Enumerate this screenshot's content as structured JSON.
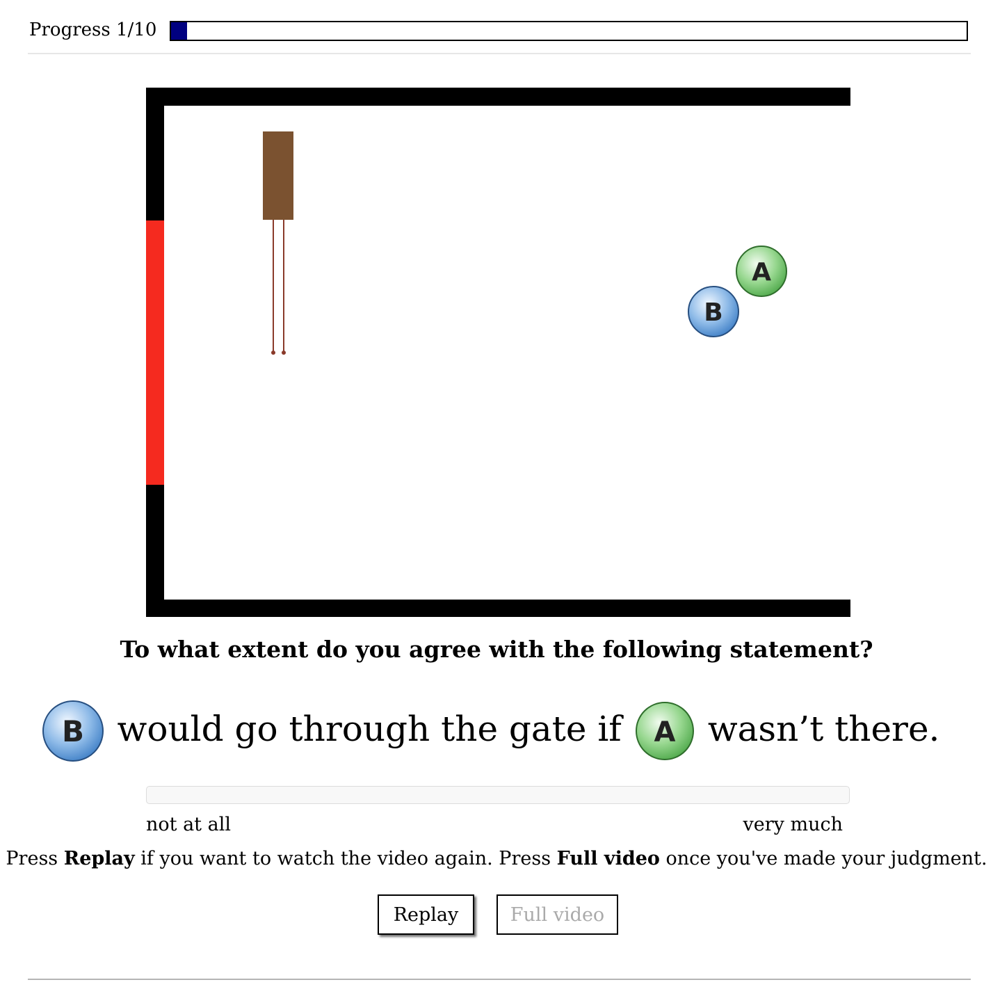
{
  "progress": {
    "label": "Progress 1/10",
    "fraction": 0.02,
    "fill_color": "#000080"
  },
  "scene": {
    "wall_color": "#000000",
    "gate_color": "#f52a1f",
    "block_color": "#7b5230",
    "balls": [
      {
        "id": "ball-a",
        "label": "A",
        "color": "#5cb85c"
      },
      {
        "id": "ball-b",
        "label": "B",
        "color": "#4a90d9"
      }
    ]
  },
  "question": "To what extent do you agree with the following statement?",
  "statement": {
    "ball_first": "B",
    "middle_text": "would go through the gate if",
    "ball_second": "A",
    "end_text": "wasn’t there."
  },
  "slider": {
    "left_label": "not at all",
    "right_label": "very much"
  },
  "instructions": {
    "part1": "Press ",
    "replay_bold": "Replay",
    "part2": " if you want to watch the video again. Press ",
    "full_bold": "Full video",
    "part3": " once you've made your judgment."
  },
  "buttons": {
    "replay": "Replay",
    "full_video": "Full video",
    "full_video_enabled": false
  }
}
